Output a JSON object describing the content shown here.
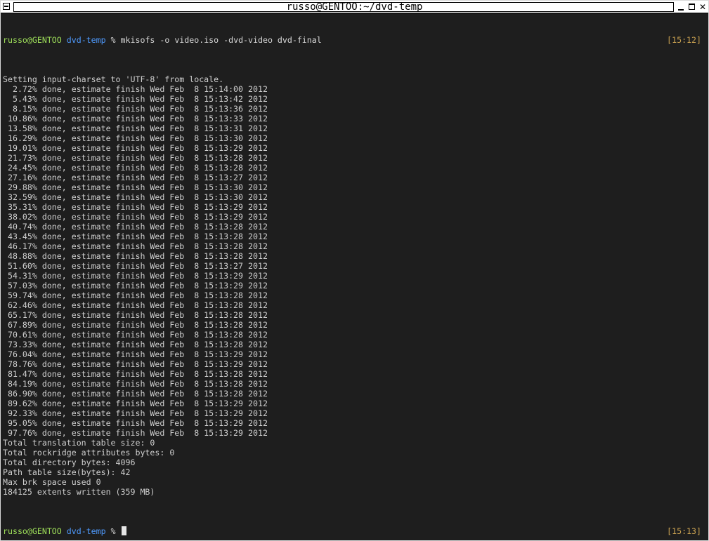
{
  "window": {
    "title": "russo@GENTOO:~/dvd-temp"
  },
  "prompt": {
    "user": "russo@GENTOO",
    "dir": "dvd-temp",
    "symbol": "%"
  },
  "command": "mkisofs -o video.iso -dvd-video dvd-final",
  "time_start": "[15:12]",
  "time_end": "[15:13]",
  "lines": [
    "Setting input-charset to 'UTF-8' from locale.",
    "  2.72% done, estimate finish Wed Feb  8 15:14:00 2012",
    "  5.43% done, estimate finish Wed Feb  8 15:13:42 2012",
    "  8.15% done, estimate finish Wed Feb  8 15:13:36 2012",
    " 10.86% done, estimate finish Wed Feb  8 15:13:33 2012",
    " 13.58% done, estimate finish Wed Feb  8 15:13:31 2012",
    " 16.29% done, estimate finish Wed Feb  8 15:13:30 2012",
    " 19.01% done, estimate finish Wed Feb  8 15:13:29 2012",
    " 21.73% done, estimate finish Wed Feb  8 15:13:28 2012",
    " 24.45% done, estimate finish Wed Feb  8 15:13:28 2012",
    " 27.16% done, estimate finish Wed Feb  8 15:13:27 2012",
    " 29.88% done, estimate finish Wed Feb  8 15:13:30 2012",
    " 32.59% done, estimate finish Wed Feb  8 15:13:30 2012",
    " 35.31% done, estimate finish Wed Feb  8 15:13:29 2012",
    " 38.02% done, estimate finish Wed Feb  8 15:13:29 2012",
    " 40.74% done, estimate finish Wed Feb  8 15:13:28 2012",
    " 43.45% done, estimate finish Wed Feb  8 15:13:28 2012",
    " 46.17% done, estimate finish Wed Feb  8 15:13:28 2012",
    " 48.88% done, estimate finish Wed Feb  8 15:13:28 2012",
    " 51.60% done, estimate finish Wed Feb  8 15:13:27 2012",
    " 54.31% done, estimate finish Wed Feb  8 15:13:29 2012",
    " 57.03% done, estimate finish Wed Feb  8 15:13:29 2012",
    " 59.74% done, estimate finish Wed Feb  8 15:13:28 2012",
    " 62.46% done, estimate finish Wed Feb  8 15:13:28 2012",
    " 65.17% done, estimate finish Wed Feb  8 15:13:28 2012",
    " 67.89% done, estimate finish Wed Feb  8 15:13:28 2012",
    " 70.61% done, estimate finish Wed Feb  8 15:13:28 2012",
    " 73.33% done, estimate finish Wed Feb  8 15:13:28 2012",
    " 76.04% done, estimate finish Wed Feb  8 15:13:29 2012",
    " 78.76% done, estimate finish Wed Feb  8 15:13:29 2012",
    " 81.47% done, estimate finish Wed Feb  8 15:13:28 2012",
    " 84.19% done, estimate finish Wed Feb  8 15:13:28 2012",
    " 86.90% done, estimate finish Wed Feb  8 15:13:28 2012",
    " 89.62% done, estimate finish Wed Feb  8 15:13:29 2012",
    " 92.33% done, estimate finish Wed Feb  8 15:13:29 2012",
    " 95.05% done, estimate finish Wed Feb  8 15:13:29 2012",
    " 97.76% done, estimate finish Wed Feb  8 15:13:29 2012",
    "Total translation table size: 0",
    "Total rockridge attributes bytes: 0",
    "Total directory bytes: 4096",
    "Path table size(bytes): 42",
    "Max brk space used 0",
    "184125 extents written (359 MB)"
  ]
}
